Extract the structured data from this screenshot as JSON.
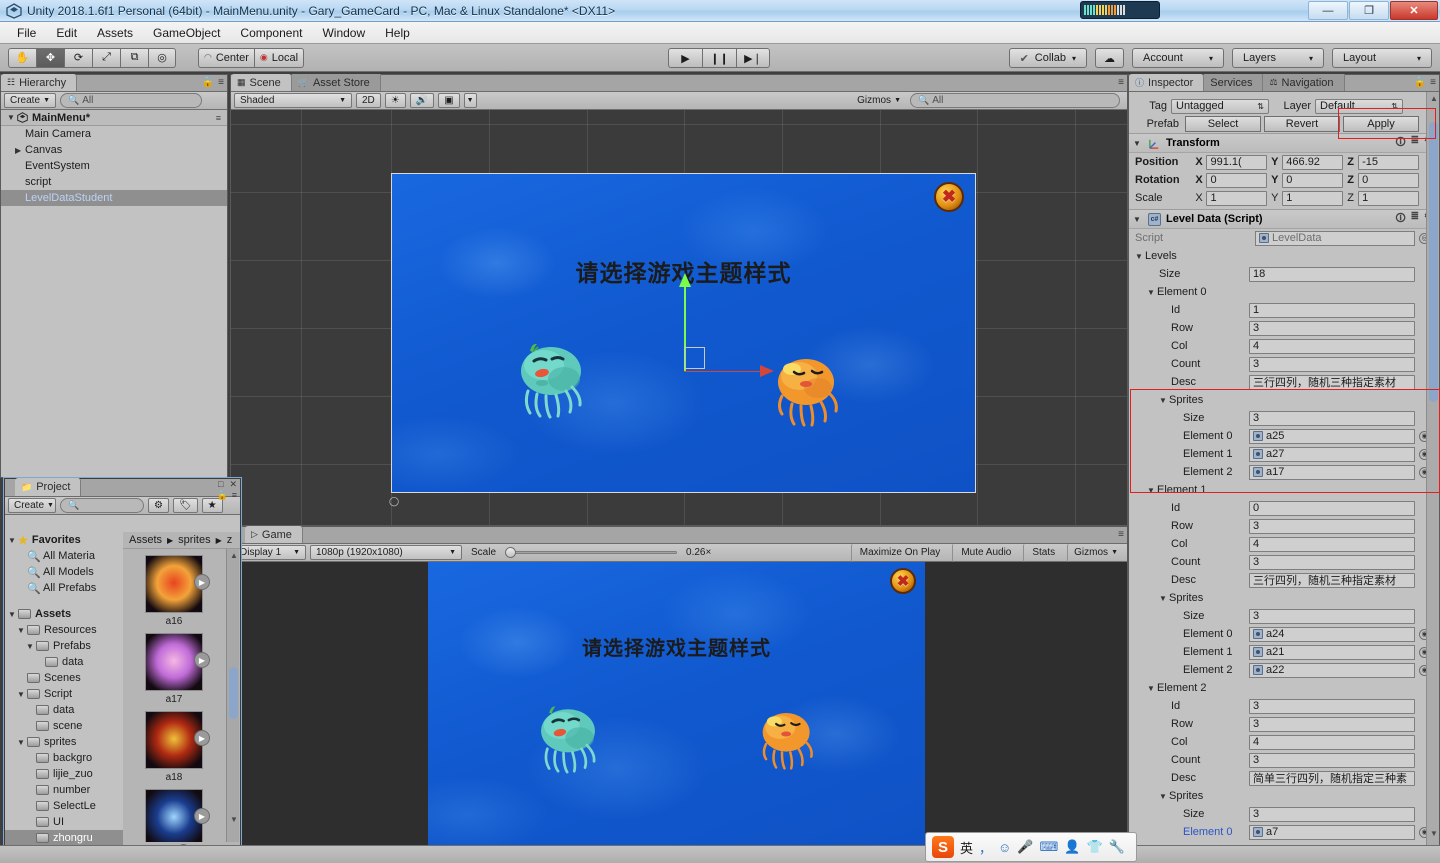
{
  "window": {
    "title": "Unity 2018.1.6f1 Personal (64bit) - MainMenu.unity - Gary_GameCard - PC, Mac & Linux Standalone* <DX11>",
    "minimize_label": "—",
    "restore_label": "❐",
    "close_label": "✕"
  },
  "menubar": {
    "items": [
      "File",
      "Edit",
      "Assets",
      "GameObject",
      "Component",
      "Window",
      "Help"
    ]
  },
  "toolbar": {
    "transform_tools": [
      "✋",
      "✥",
      "⟳",
      "⤢",
      "⧉",
      "◎"
    ],
    "active_tool_index": 1,
    "pivot_label": "Center",
    "rotation_label": "Local",
    "play_label": "▶",
    "pause_label": "❙❙",
    "step_label": "▶❘",
    "collab_label": "Collab",
    "cloud_label": "☁",
    "account_label": "Account",
    "layers_label": "Layers",
    "layout_label": "Layout",
    "caret": "▾"
  },
  "hierarchy": {
    "tab_label": "Hierarchy",
    "create_label": "Create",
    "search_placeholder": "All",
    "scene_name": "MainMenu*",
    "items": [
      {
        "label": "Main Camera",
        "expandable": false,
        "selected": false,
        "indent": 1
      },
      {
        "label": "Canvas",
        "expandable": true,
        "selected": false,
        "indent": 1
      },
      {
        "label": "EventSystem",
        "expandable": false,
        "selected": false,
        "indent": 1
      },
      {
        "label": "script",
        "expandable": false,
        "selected": false,
        "indent": 1
      },
      {
        "label": "LevelDataStudent",
        "expandable": false,
        "selected": true,
        "indent": 1
      }
    ]
  },
  "scene_view": {
    "tabs": [
      "Scene",
      "Asset Store"
    ],
    "active_tab": "Scene",
    "shading_label": "Shaded",
    "mode_2d_label": "2D",
    "light_icon": "☀",
    "audio_icon": "ὐA",
    "fx_icon": "▣",
    "gizmos_label": "Gizmos",
    "search_placeholder": "All",
    "content": {
      "title_text": "请选择游戏主题样式",
      "close_button_label": "✖"
    }
  },
  "game_view": {
    "tab_label": "Game",
    "display_label": "Display 1",
    "resolution_label": "1080p (1920x1080)",
    "scale_label": "Scale",
    "scale_value": "0.26×",
    "maximize_label": "Maximize On Play",
    "mute_label": "Mute Audio",
    "stats_label": "Stats",
    "gizmos_label": "Gizmos",
    "content": {
      "title_text": "请选择游戏主题样式",
      "close_button_label": "✖"
    }
  },
  "project": {
    "tab_label": "Project",
    "create_label": "Create",
    "search_placeholder": "",
    "breadcrumb": [
      "Assets",
      "sprites",
      "z"
    ],
    "tree": [
      {
        "label": "Favorites",
        "indent": 0,
        "type": "star",
        "expanded": true,
        "selected": false
      },
      {
        "label": "All Materia",
        "indent": 1,
        "type": "search",
        "expanded": false,
        "selected": false
      },
      {
        "label": "All Models",
        "indent": 1,
        "type": "search",
        "expanded": false,
        "selected": false
      },
      {
        "label": "All Prefabs",
        "indent": 1,
        "type": "search",
        "expanded": false,
        "selected": false
      },
      {
        "label": "",
        "indent": 0,
        "type": "gap",
        "expanded": false,
        "selected": false
      },
      {
        "label": "Assets",
        "indent": 0,
        "type": "folder",
        "expanded": true,
        "selected": false
      },
      {
        "label": "Resources",
        "indent": 1,
        "type": "folder",
        "expanded": true,
        "selected": false
      },
      {
        "label": "Prefabs",
        "indent": 2,
        "type": "folder",
        "expanded": true,
        "selected": false
      },
      {
        "label": "data",
        "indent": 3,
        "type": "folder",
        "expanded": false,
        "selected": false
      },
      {
        "label": "Scenes",
        "indent": 1,
        "type": "folder",
        "expanded": false,
        "selected": false
      },
      {
        "label": "Script",
        "indent": 1,
        "type": "folder",
        "expanded": true,
        "selected": false
      },
      {
        "label": "data",
        "indent": 2,
        "type": "folder",
        "expanded": false,
        "selected": false
      },
      {
        "label": "scene",
        "indent": 2,
        "type": "folder",
        "expanded": false,
        "selected": false
      },
      {
        "label": "sprites",
        "indent": 1,
        "type": "folder",
        "expanded": true,
        "selected": false
      },
      {
        "label": "backgro",
        "indent": 2,
        "type": "folder",
        "expanded": false,
        "selected": false
      },
      {
        "label": "lijie_zuo",
        "indent": 2,
        "type": "folder",
        "expanded": false,
        "selected": false
      },
      {
        "label": "number",
        "indent": 2,
        "type": "folder",
        "expanded": false,
        "selected": false
      },
      {
        "label": "SelectLe",
        "indent": 2,
        "type": "folder",
        "expanded": false,
        "selected": false
      },
      {
        "label": "UI",
        "indent": 2,
        "type": "folder",
        "expanded": false,
        "selected": false
      },
      {
        "label": "zhongru",
        "indent": 2,
        "type": "folder",
        "expanded": false,
        "selected": true
      }
    ],
    "assets": [
      {
        "name": "a16",
        "color_a": "#e8441f",
        "color_b": "#f3a33a"
      },
      {
        "name": "a17",
        "color_a": "#f5b8e4",
        "color_b": "#c06bd8"
      },
      {
        "name": "a18",
        "color_a": "#f0c23a",
        "color_b": "#b02a12"
      },
      {
        "name": "",
        "color_a": "#9fd6ff",
        "color_b": "#1a3d8f"
      }
    ]
  },
  "inspector": {
    "tabs": [
      "Inspector",
      "Services",
      "Navigation"
    ],
    "active_tab": "Inspector",
    "tag_label": "Tag",
    "tag_value": "Untagged",
    "layer_label": "Layer",
    "layer_value": "Default",
    "prefab_label": "Prefab",
    "prefab_buttons": [
      "Select",
      "Revert",
      "Apply"
    ],
    "transform": {
      "title": "Transform",
      "rows": [
        {
          "label": "Position",
          "x": "991.1(",
          "y": "466.92",
          "z": "-15"
        },
        {
          "label": "Rotation",
          "x": "0",
          "y": "0",
          "z": "0"
        },
        {
          "label": "Scale",
          "x": "1",
          "y": "1",
          "z": "1"
        }
      ],
      "axes": [
        "X",
        "Y",
        "Z"
      ]
    },
    "script_component": {
      "title": "Level Data (Script)",
      "script_label": "Script",
      "script_value": "LevelData",
      "levels_label": "Levels",
      "size_label": "Size",
      "size_value": "18",
      "sprites_label": "Sprites",
      "field_labels": [
        "Id",
        "Row",
        "Col",
        "Count",
        "Desc"
      ],
      "elements": [
        {
          "name": "Element 0",
          "id": "1",
          "row": "3",
          "col": "4",
          "count": "3",
          "desc": "三行四列，随机三种指定素材",
          "sprites_size": "3",
          "sprites": [
            {
              "label": "Element 0",
              "value": "a25"
            },
            {
              "label": "Element 1",
              "value": "a27"
            },
            {
              "label": "Element 2",
              "value": "a17"
            }
          ]
        },
        {
          "name": "Element 1",
          "id": "0",
          "row": "3",
          "col": "4",
          "count": "3",
          "desc": "三行四列，随机三种指定素材",
          "sprites_size": "3",
          "sprites": [
            {
              "label": "Element 0",
              "value": "a24"
            },
            {
              "label": "Element 1",
              "value": "a21"
            },
            {
              "label": "Element 2",
              "value": "a22"
            }
          ]
        },
        {
          "name": "Element 2",
          "id": "3",
          "row": "3",
          "col": "4",
          "count": "3",
          "desc": "简单三行四列，随机指定三种素",
          "sprites_size": "3",
          "sprites": [
            {
              "label": "Element 0",
              "value": "a7"
            }
          ]
        }
      ]
    }
  },
  "ime": {
    "logo_label": "S",
    "mode_label": "英",
    "punct_label": "，",
    "emoji_icon": "☺",
    "mic_icon": "Ἲ4",
    "keyboard_icon": "⌨",
    "user_icon": "὆4",
    "skin_icon": "ὅ5",
    "tools_icon": "ὒ7"
  },
  "colors": {
    "accent": "#3b6fd4",
    "highlight": "#e02020",
    "selection": "#8f8f8f",
    "panel_bg": "#c2c2c2"
  }
}
